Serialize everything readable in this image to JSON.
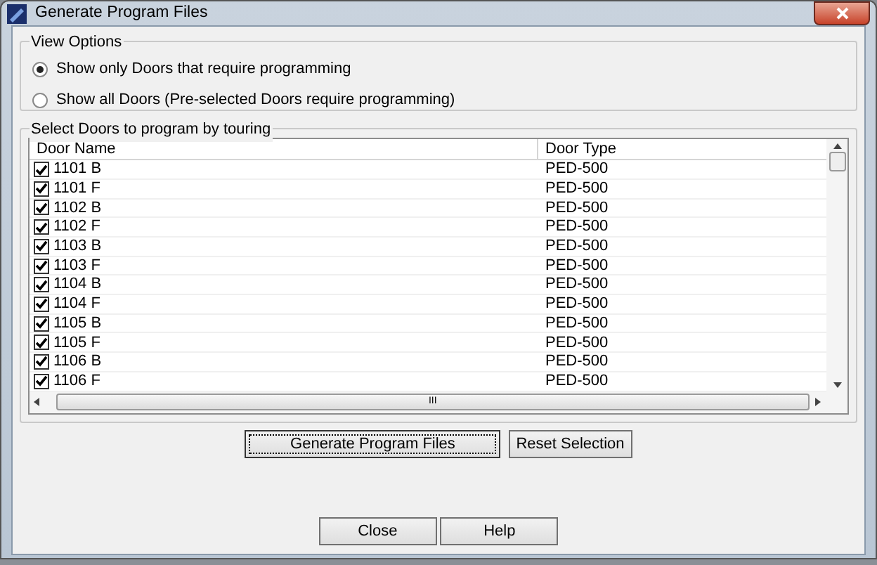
{
  "window": {
    "title": "Generate Program Files"
  },
  "view_options": {
    "title": "View Options",
    "options": [
      {
        "label": "Show only Doors that require programming",
        "selected": true
      },
      {
        "label": "Show all Doors (Pre-selected Doors require programming)",
        "selected": false
      }
    ]
  },
  "doors": {
    "title": "Select Doors to program by touring",
    "columns": [
      "Door Name",
      "Door Type"
    ],
    "rows": [
      {
        "name": "1101 B",
        "type": "PED-500",
        "checked": true
      },
      {
        "name": "1101 F",
        "type": "PED-500",
        "checked": true
      },
      {
        "name": "1102 B",
        "type": "PED-500",
        "checked": true
      },
      {
        "name": "1102 F",
        "type": "PED-500",
        "checked": true
      },
      {
        "name": "1103 B",
        "type": "PED-500",
        "checked": true
      },
      {
        "name": "1103 F",
        "type": "PED-500",
        "checked": true
      },
      {
        "name": "1104 B",
        "type": "PED-500",
        "checked": true
      },
      {
        "name": "1104 F",
        "type": "PED-500",
        "checked": true
      },
      {
        "name": "1105 B",
        "type": "PED-500",
        "checked": true
      },
      {
        "name": "1105 F",
        "type": "PED-500",
        "checked": true
      },
      {
        "name": "1106 B",
        "type": "PED-500",
        "checked": true
      },
      {
        "name": "1106 F",
        "type": "PED-500",
        "checked": true
      }
    ],
    "horizontal_scroll_grip": "III"
  },
  "action_buttons": [
    "Generate Program Files",
    "Reset Selection"
  ],
  "footer_buttons": [
    "Close",
    "Help"
  ]
}
